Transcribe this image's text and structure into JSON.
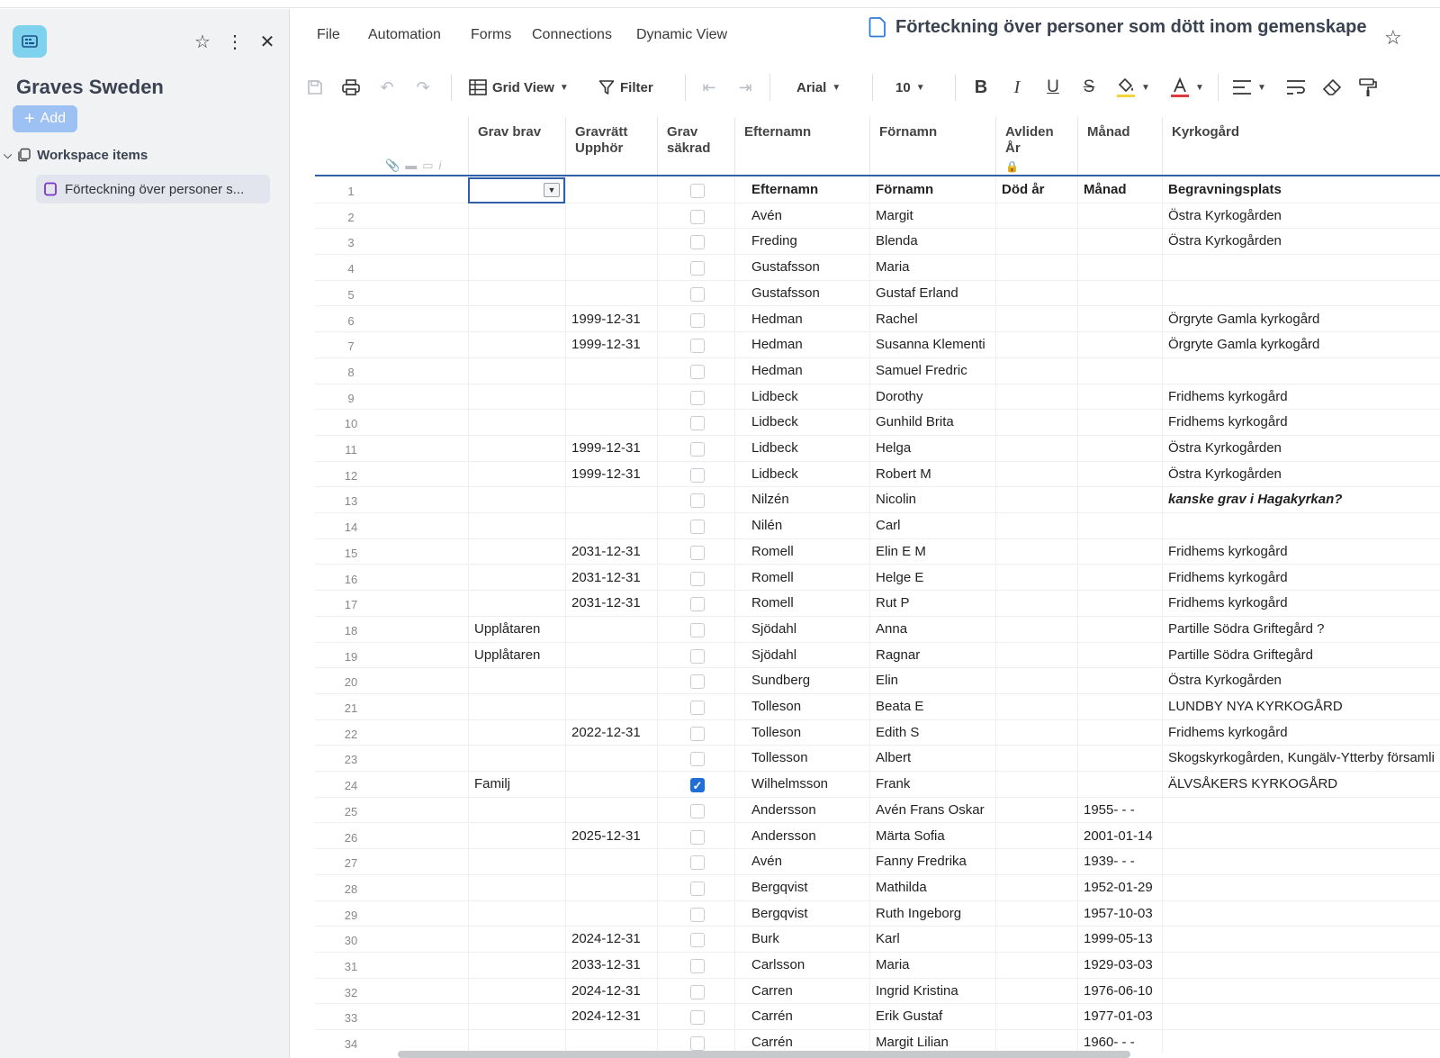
{
  "sidebar": {
    "workspace_name": "Graves Sweden",
    "add_label": "Add",
    "section_label": "Workspace items",
    "item_label": "Förteckning över personer s..."
  },
  "menu": {
    "items": [
      "File",
      "Automation",
      "Forms",
      "Connections",
      "Dynamic View"
    ]
  },
  "document": {
    "title": "Förteckning över personer som dött inom gemenskape"
  },
  "toolbar": {
    "view_label": "Grid View",
    "filter_label": "Filter",
    "font": "Arial",
    "font_size": "10",
    "accent_color": "#2f5fa8",
    "text_color_underline": "#e03a3a",
    "fill_color_underline": "#f2d53c"
  },
  "columns": {
    "c1": "Grav brav",
    "c2a": "Gravrätt",
    "c2b": "Upphör",
    "c3a": "Grav",
    "c3b": "säkrad",
    "c4": "Efternamn",
    "c5": "Förnamn",
    "c6a": "Avliden",
    "c6b": "År",
    "c7": "Månad",
    "c8": "Kyrkogård"
  },
  "rows": [
    {
      "n": "1",
      "a": "",
      "b": "",
      "checked": false,
      "c": "Efternamn",
      "d": "Förnamn",
      "e": "Död år",
      "f": "Månad",
      "g": "Begravningsplats",
      "style": "bold"
    },
    {
      "n": "2",
      "a": "",
      "b": "",
      "checked": false,
      "c": "Avén",
      "d": "Margit",
      "e": "",
      "f": "",
      "g": "Östra Kyrkogården"
    },
    {
      "n": "3",
      "a": "",
      "b": "",
      "checked": false,
      "c": "Freding",
      "d": "Blenda",
      "e": "",
      "f": "",
      "g": "Östra Kyrkogården"
    },
    {
      "n": "4",
      "a": "",
      "b": "",
      "checked": false,
      "c": "Gustafsson",
      "d": "Maria",
      "e": "",
      "f": "",
      "g": ""
    },
    {
      "n": "5",
      "a": "",
      "b": "",
      "checked": false,
      "c": "Gustafsson",
      "d": "Gustaf Erland",
      "e": "",
      "f": "",
      "g": ""
    },
    {
      "n": "6",
      "a": "",
      "b": "1999-12-31",
      "checked": false,
      "c": "Hedman",
      "d": "Rachel",
      "e": "",
      "f": "",
      "g": "Örgryte Gamla kyrkogård"
    },
    {
      "n": "7",
      "a": "",
      "b": "1999-12-31",
      "checked": false,
      "c": "Hedman",
      "d": "Susanna Klementi",
      "e": "",
      "f": "",
      "g": "Örgryte Gamla kyrkogård"
    },
    {
      "n": "8",
      "a": "",
      "b": "",
      "checked": false,
      "c": "Hedman",
      "d": "Samuel Fredric",
      "e": "",
      "f": "",
      "g": ""
    },
    {
      "n": "9",
      "a": "",
      "b": "",
      "checked": false,
      "c": "Lidbeck",
      "d": "Dorothy",
      "e": "",
      "f": "",
      "g": "Fridhems kyrkogård"
    },
    {
      "n": "10",
      "a": "",
      "b": "",
      "checked": false,
      "c": "Lidbeck",
      "d": "Gunhild Brita",
      "e": "",
      "f": "",
      "g": "Fridhems kyrkogård"
    },
    {
      "n": "11",
      "a": "",
      "b": "1999-12-31",
      "checked": false,
      "c": "Lidbeck",
      "d": "Helga",
      "e": "",
      "f": "",
      "g": "Östra Kyrkogården"
    },
    {
      "n": "12",
      "a": "",
      "b": "1999-12-31",
      "checked": false,
      "c": "Lidbeck",
      "d": "Robert M",
      "e": "",
      "f": "",
      "g": "Östra Kyrkogården"
    },
    {
      "n": "13",
      "a": "",
      "b": "",
      "checked": false,
      "c": "Nilzén",
      "d": "Nicolin",
      "e": "",
      "f": "",
      "g": "kanske grav i Hagakyrkan?",
      "gstyle": "bi"
    },
    {
      "n": "14",
      "a": "",
      "b": "",
      "checked": false,
      "c": "Nilén",
      "d": "Carl",
      "e": "",
      "f": "",
      "g": ""
    },
    {
      "n": "15",
      "a": "",
      "b": "2031-12-31",
      "checked": false,
      "c": "Romell",
      "d": "Elin E M",
      "e": "",
      "f": "",
      "g": "Fridhems kyrkogård"
    },
    {
      "n": "16",
      "a": "",
      "b": "2031-12-31",
      "checked": false,
      "c": "Romell",
      "d": "Helge E",
      "e": "",
      "f": "",
      "g": "Fridhems kyrkogård"
    },
    {
      "n": "17",
      "a": "",
      "b": "2031-12-31",
      "checked": false,
      "c": "Romell",
      "d": "Rut P",
      "e": "",
      "f": "",
      "g": "Fridhems kyrkogård"
    },
    {
      "n": "18",
      "a": "Upplåtaren",
      "b": "",
      "checked": false,
      "c": "Sjödahl",
      "d": "Anna",
      "e": "",
      "f": "",
      "g": "Partille Södra Griftegård ?"
    },
    {
      "n": "19",
      "a": "Upplåtaren",
      "b": "",
      "checked": false,
      "c": "Sjödahl",
      "d": "Ragnar",
      "e": "",
      "f": "",
      "g": "Partille Södra Griftegård"
    },
    {
      "n": "20",
      "a": "",
      "b": "",
      "checked": false,
      "c": "Sundberg",
      "d": "Elin",
      "e": "",
      "f": "",
      "g": "Östra Kyrkogården"
    },
    {
      "n": "21",
      "a": "",
      "b": "",
      "checked": false,
      "c": "Tolleson",
      "d": "Beata E",
      "e": "",
      "f": "",
      "g": "LUNDBY NYA KYRKOGÅRD"
    },
    {
      "n": "22",
      "a": "",
      "b": "2022-12-31",
      "checked": false,
      "c": "Tolleson",
      "d": "Edith S",
      "e": "",
      "f": "",
      "g": "Fridhems kyrkogård"
    },
    {
      "n": "23",
      "a": "",
      "b": "",
      "checked": false,
      "c": "Tollesson",
      "d": "Albert",
      "e": "",
      "f": "",
      "g": "Skogskyrkogården, Kungälv-Ytterby församli"
    },
    {
      "n": "24",
      "a": "Familj",
      "b": "",
      "checked": true,
      "c": "Wilhelmsson",
      "d": "Frank",
      "e": "",
      "f": "",
      "g": "ÄLVSÅKERS KYRKOGÅRD"
    },
    {
      "n": "25",
      "a": "",
      "b": "",
      "checked": false,
      "c": "Andersson",
      "d": "Avén Frans Oskar",
      "e": "",
      "f": "1955- - -",
      "g": ""
    },
    {
      "n": "26",
      "a": "",
      "b": "2025-12-31",
      "checked": false,
      "c": "Andersson",
      "d": "Märta Sofia",
      "e": "",
      "f": "2001-01-14",
      "g": ""
    },
    {
      "n": "27",
      "a": "",
      "b": "",
      "checked": false,
      "c": "Avén",
      "d": "Fanny Fredrika",
      "e": "",
      "f": "1939- - -",
      "g": ""
    },
    {
      "n": "28",
      "a": "",
      "b": "",
      "checked": false,
      "c": "Bergqvist",
      "d": "Mathilda",
      "e": "",
      "f": "1952-01-29",
      "g": ""
    },
    {
      "n": "29",
      "a": "",
      "b": "",
      "checked": false,
      "c": "Bergqvist",
      "d": "Ruth Ingeborg",
      "e": "",
      "f": "1957-10-03",
      "g": ""
    },
    {
      "n": "30",
      "a": "",
      "b": "2024-12-31",
      "checked": false,
      "c": "Burk",
      "d": "Karl",
      "e": "",
      "f": "1999-05-13",
      "g": ""
    },
    {
      "n": "31",
      "a": "",
      "b": "2033-12-31",
      "checked": false,
      "c": "Carlsson",
      "d": "Maria",
      "e": "",
      "f": "1929-03-03",
      "g": ""
    },
    {
      "n": "32",
      "a": "",
      "b": "2024-12-31",
      "checked": false,
      "c": "Carren",
      "d": "Ingrid Kristina",
      "e": "",
      "f": "1976-06-10",
      "g": ""
    },
    {
      "n": "33",
      "a": "",
      "b": "2024-12-31",
      "checked": false,
      "c": "Carrén",
      "d": "Erik Gustaf",
      "e": "",
      "f": "1977-01-03",
      "g": ""
    },
    {
      "n": "34",
      "a": "",
      "b": "",
      "checked": false,
      "c": "Carrén",
      "d": "Margit Lilian",
      "e": "",
      "f": "1960- - -",
      "g": ""
    }
  ]
}
